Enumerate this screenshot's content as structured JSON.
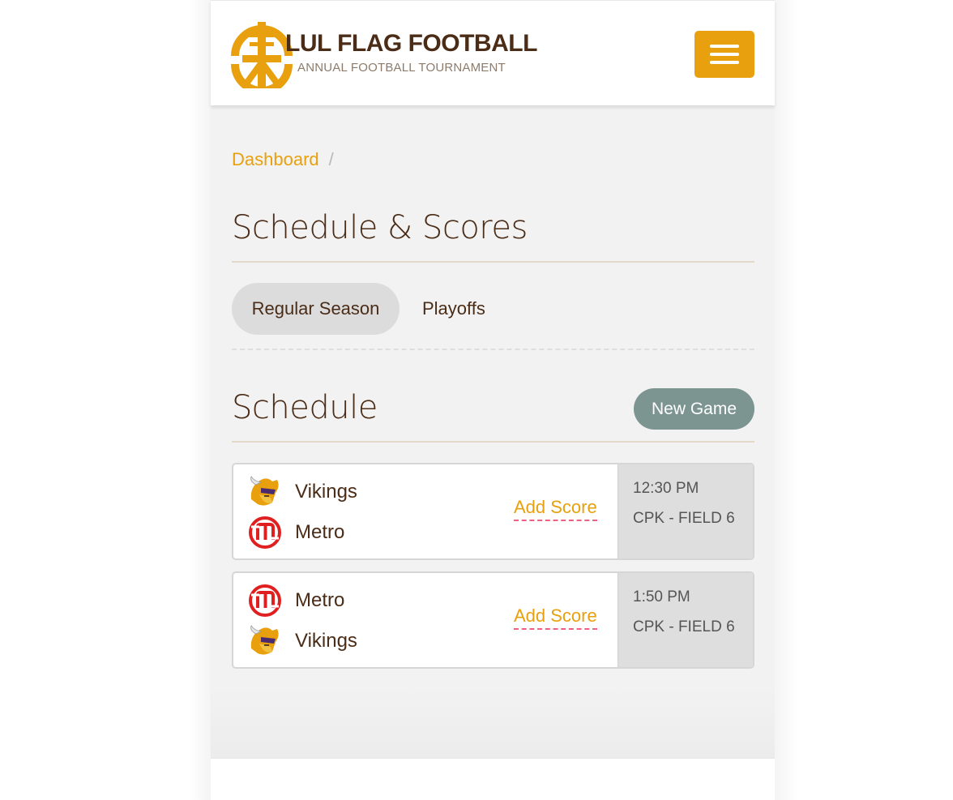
{
  "header": {
    "brand_title": "LUL FLAG FOOTBALL",
    "brand_subtitle": "ANNUAL FOOTBALL TOURNAMENT",
    "logo_icon": "football-goalpost-logo",
    "menu_icon": "hamburger-menu-icon",
    "accent_color": "#e8a00e"
  },
  "breadcrumb": {
    "items": [
      "Dashboard"
    ],
    "separator": "/"
  },
  "page": {
    "title": "Schedule & Scores"
  },
  "tabs": [
    {
      "label": "Regular Season",
      "active": true
    },
    {
      "label": "Playoffs",
      "active": false
    }
  ],
  "schedule": {
    "title": "Schedule",
    "new_game_label": "New Game",
    "games": [
      {
        "teams": [
          {
            "name": "Vikings",
            "logo": "vikings-logo"
          },
          {
            "name": "Metro",
            "logo": "metro-logo"
          }
        ],
        "action": "Add Score",
        "time": "12:30 PM",
        "field": "CPK - FIELD 6"
      },
      {
        "teams": [
          {
            "name": "Metro",
            "logo": "metro-logo"
          },
          {
            "name": "Vikings",
            "logo": "vikings-logo"
          }
        ],
        "action": "Add Score",
        "time": "1:50 PM",
        "field": "CPK - FIELD 6"
      }
    ]
  }
}
